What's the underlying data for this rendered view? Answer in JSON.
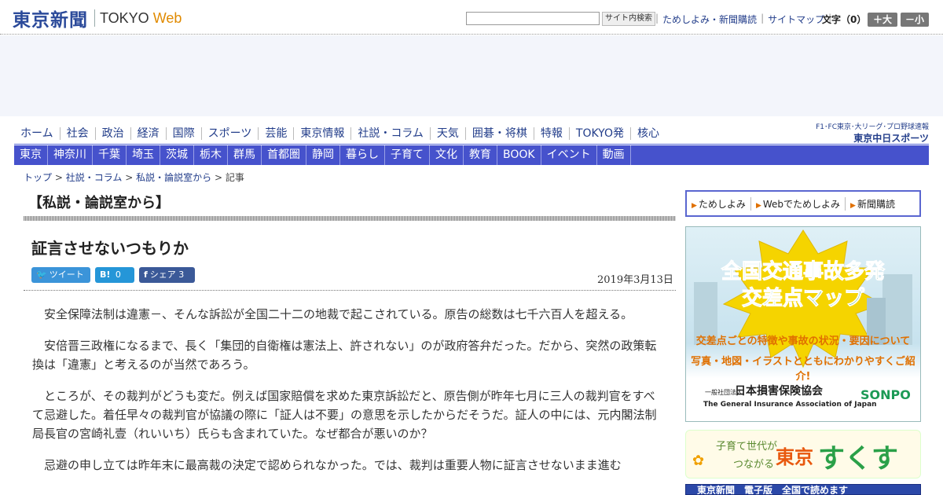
{
  "header": {
    "logo_jp": "東京新聞",
    "logo_en_1": "TOKYO",
    "logo_en_2": "Web",
    "search_button": "サイト内検索",
    "links": [
      "ためしよみ・新聞購読",
      "サイトマップ"
    ],
    "font_size_label": "文字（0）",
    "font_larger": "＋大",
    "font_smaller": "－小"
  },
  "nav_primary": [
    "ホーム",
    "社会",
    "政治",
    "経済",
    "国際",
    "スポーツ",
    "芸能",
    "東京情報",
    "社説・コラム",
    "天気",
    "囲碁・将棋",
    "特報",
    "TOKYO発",
    "核心"
  ],
  "sponsor": {
    "line1": "F1･FC東京･大リーグ･プロ野球速報",
    "line2": "東京中日スポーツ"
  },
  "nav_regional": [
    "東京",
    "神奈川",
    "千葉",
    "埼玉",
    "茨城",
    "栃木",
    "群馬",
    "首都圏",
    "静岡",
    "暮らし",
    "子育て",
    "文化",
    "教育",
    "BOOK",
    "イベント",
    "動画"
  ],
  "breadcrumb": {
    "items": [
      "トップ",
      "社説・コラム",
      "私説・論説室から"
    ],
    "current": "記事",
    "separator": ">"
  },
  "section_title": "【私説・論説室から】",
  "article": {
    "title": "証言させないつもりか",
    "date": "2019年3月13日",
    "share": {
      "tweet": "ツイート",
      "hatena_icon": "B!",
      "hatena_count": "0",
      "fb_share": "シェア",
      "fb_count": "3"
    },
    "paragraphs": [
      "安全保障法制は違憲－、そんな訴訟が全国二十二の地裁で起こされている。原告の総数は七千六百人を超える。",
      "安倍晋三政権になるまで、長く「集団的自衛権は憲法上、許されない」のが政府答弁だった。だから、突然の政策転換は「違憲」と考えるのが当然であろう。",
      "ところが、その裁判がどうも変だ。例えば国家賠償を求めた東京訴訟だと、原告側が昨年七月に三人の裁判官をすべて忌避した。着任早々の裁判官が協議の際に「証人は不要」の意思を示したからだそうだ。証人の中には、元内閣法制局長官の宮崎礼壹（れいいち）氏らも含まれていた。なぜ都合が悪いのか？",
      "忌避の申し立ては昨年末に最高裁の決定で認められなかった。では、裁判は重要人物に証言させないまま進む"
    ]
  },
  "sidebar": {
    "subscribe": [
      "ためしよみ",
      "Webでためしよみ",
      "新聞購読"
    ],
    "ad_traffic": {
      "headline1": "全国交通事故多発",
      "headline2": "交差点マップ",
      "desc1": "交差点ごとの特徴や事故の状況・要因について",
      "desc2": "写真・地図・イラストとともにわかりやすくご紹介!",
      "org_small": "一般社団法人",
      "org": "日本損害保険協会",
      "org_en": "The General Insurance Association of Japan",
      "brand": "SONPO"
    },
    "ad_sukusuku": {
      "line1": "子育て世代が",
      "line2": "つながる",
      "city": "東京",
      "brand": "すくすく"
    },
    "ad_bottom": "東京新聞　電子版　全国で読めます"
  }
}
